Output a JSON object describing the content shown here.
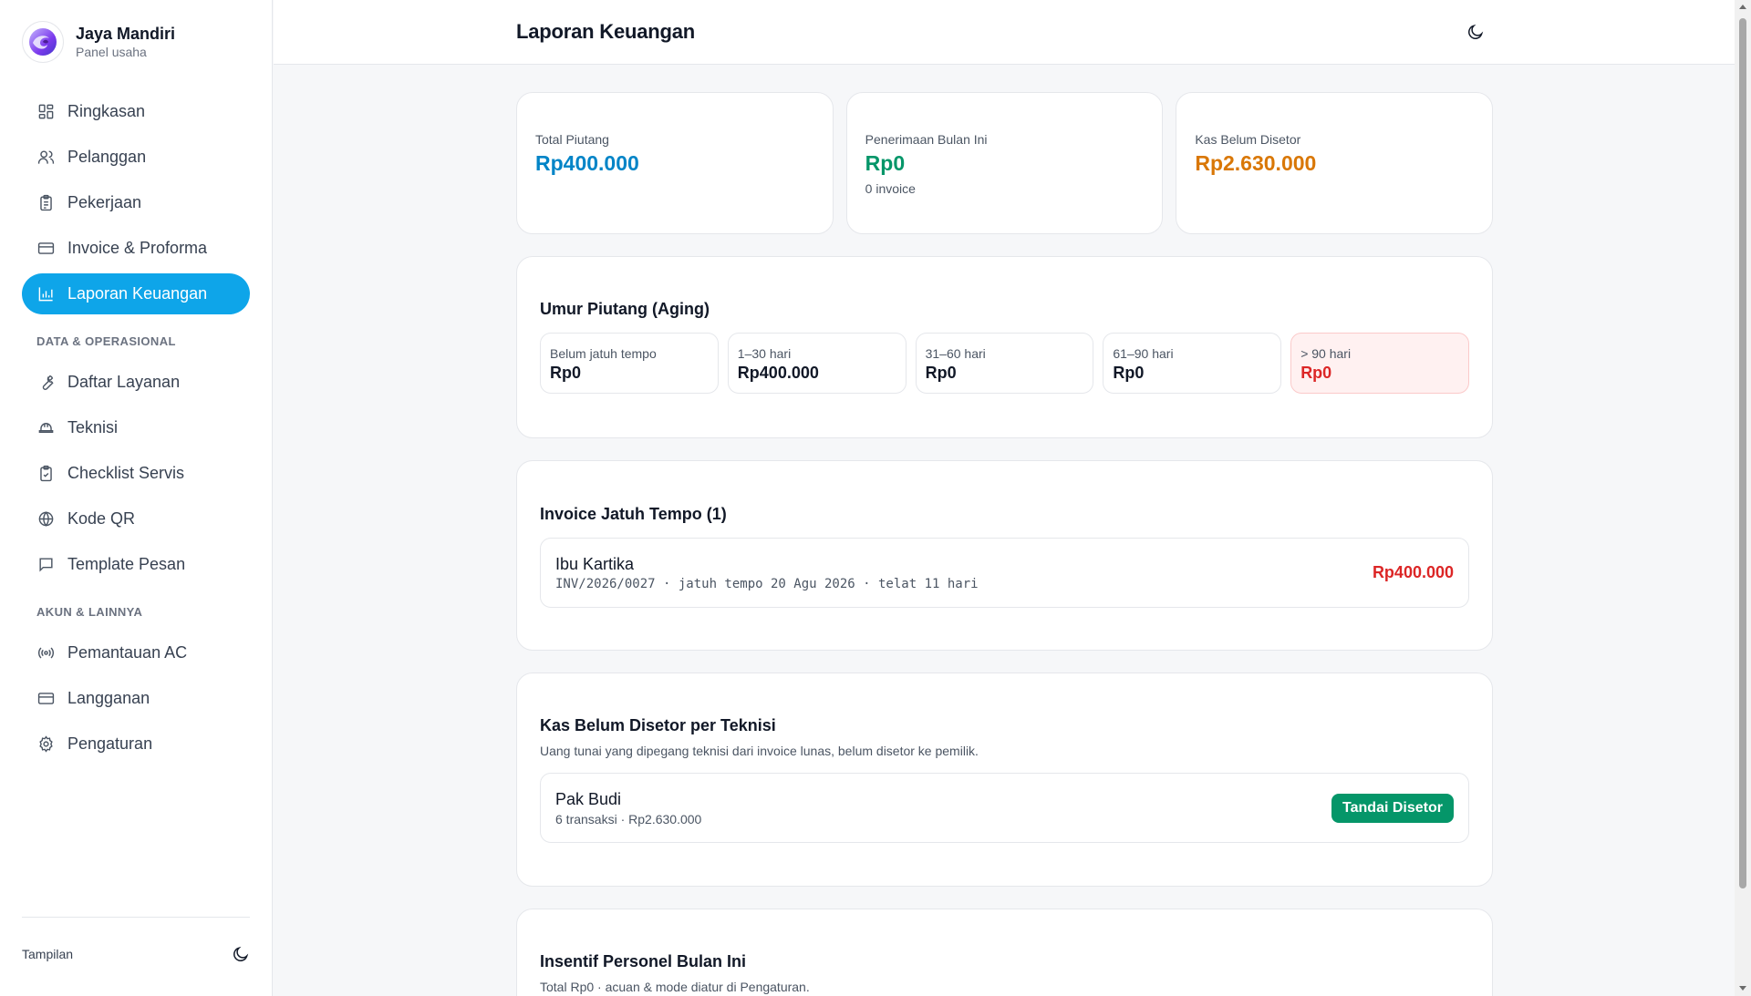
{
  "brand": {
    "name": "Jaya Mandiri",
    "subtitle": "Panel usaha"
  },
  "nav": {
    "main": [
      {
        "label": "Ringkasan",
        "icon": "dashboard-icon"
      },
      {
        "label": "Pelanggan",
        "icon": "users-icon"
      },
      {
        "label": "Pekerjaan",
        "icon": "clipboard-list-icon"
      },
      {
        "label": "Invoice & Proforma",
        "icon": "credit-card-icon"
      },
      {
        "label": "Laporan Keuangan",
        "icon": "bar-chart-icon",
        "active": true
      }
    ],
    "section_data": "DATA & OPERASIONAL",
    "data": [
      {
        "label": "Daftar Layanan",
        "icon": "wrench-icon"
      },
      {
        "label": "Teknisi",
        "icon": "hard-hat-icon"
      },
      {
        "label": "Checklist Servis",
        "icon": "clipboard-check-icon"
      },
      {
        "label": "Kode QR",
        "icon": "globe-icon"
      },
      {
        "label": "Template Pesan",
        "icon": "message-square-icon"
      }
    ],
    "section_account": "AKUN & LAINNYA",
    "account": [
      {
        "label": "Pemantauan AC",
        "icon": "radio-icon"
      },
      {
        "label": "Langganan",
        "icon": "credit-card-icon"
      },
      {
        "label": "Pengaturan",
        "icon": "gear-icon"
      }
    ]
  },
  "sidebar_footer": {
    "label": "Tampilan",
    "icon": "moon-icon"
  },
  "header": {
    "title": "Laporan Keuangan",
    "theme_icon": "moon-icon"
  },
  "stats": [
    {
      "label": "Total Piutang",
      "value": "Rp400.000",
      "color": "#0284c7",
      "sub": ""
    },
    {
      "label": "Penerimaan Bulan Ini",
      "value": "Rp0",
      "color": "#059669",
      "sub": "0 invoice"
    },
    {
      "label": "Kas Belum Disetor",
      "value": "Rp2.630.000",
      "color": "#d97706",
      "sub": ""
    }
  ],
  "aging": {
    "title": "Umur Piutang (Aging)",
    "buckets": [
      {
        "label": "Belum jatuh tempo",
        "value": "Rp0"
      },
      {
        "label": "1–30 hari",
        "value": "Rp400.000"
      },
      {
        "label": "31–60 hari",
        "value": "Rp0"
      },
      {
        "label": "61–90 hari",
        "value": "Rp0"
      },
      {
        "label": "> 90 hari",
        "value": "Rp0"
      }
    ]
  },
  "due": {
    "title": "Invoice Jatuh Tempo (1)",
    "items": [
      {
        "name": "Ibu Kartika",
        "meta": "INV/2026/0027 · jatuh tempo 20 Agu 2026 · telat 11 hari",
        "amount": "Rp400.000"
      }
    ]
  },
  "cash": {
    "title": "Kas Belum Disetor per Teknisi",
    "description": "Uang tunai yang dipegang teknisi dari invoice lunas, belum disetor ke pemilik.",
    "items": [
      {
        "name": "Pak Budi",
        "meta": "6 transaksi · Rp2.630.000",
        "action": "Tandai Disetor"
      }
    ]
  },
  "incentive": {
    "title": "Insentif Personel Bulan Ini",
    "description": "Total Rp0 · acuan & mode diatur di Pengaturan."
  }
}
